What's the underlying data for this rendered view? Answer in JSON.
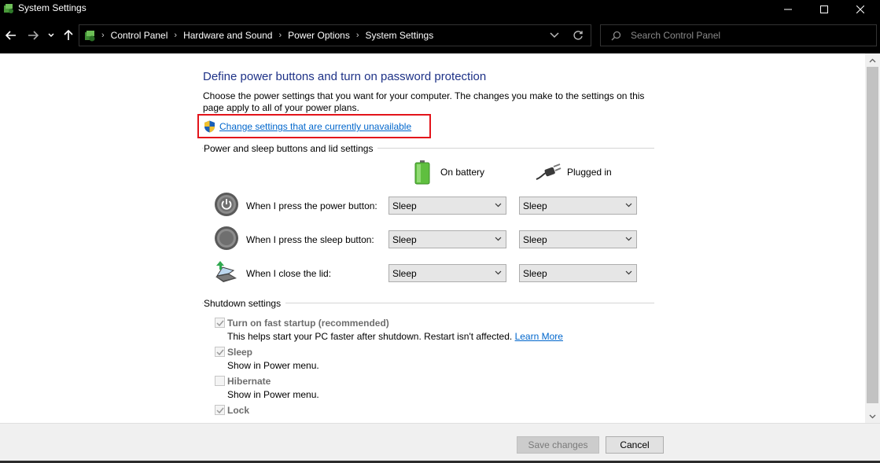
{
  "window": {
    "title": "System Settings"
  },
  "address_bar": {
    "breadcrumbs": [
      "Control Panel",
      "Hardware and Sound",
      "Power Options",
      "System Settings"
    ],
    "search_placeholder": "Search Control Panel"
  },
  "page": {
    "heading": "Define power buttons and turn on password protection",
    "description": "Choose the power settings that you want for your computer. The changes you make to the settings on this page apply to all of your power plans.",
    "change_settings_link": "Change settings that are currently unavailable"
  },
  "power_buttons": {
    "group_title": "Power and sleep buttons and lid settings",
    "columns": {
      "battery": "On battery",
      "plugged": "Plugged in"
    },
    "rows": [
      {
        "label": "When I press the power button:",
        "battery": "Sleep",
        "plugged": "Sleep"
      },
      {
        "label": "When I press the sleep button:",
        "battery": "Sleep",
        "plugged": "Sleep"
      },
      {
        "label": "When I close the lid:",
        "battery": "Sleep",
        "plugged": "Sleep"
      }
    ]
  },
  "shutdown": {
    "group_title": "Shutdown settings",
    "items": [
      {
        "label": "Turn on fast startup (recommended)",
        "checked": true,
        "description": "This helps start your PC faster after shutdown. Restart isn't affected.",
        "link": "Learn More"
      },
      {
        "label": "Sleep",
        "checked": true,
        "description": "Show in Power menu."
      },
      {
        "label": "Hibernate",
        "checked": false,
        "description": "Show in Power menu."
      },
      {
        "label": "Lock",
        "checked": true,
        "description": ""
      }
    ]
  },
  "footer": {
    "save_label": "Save changes",
    "cancel_label": "Cancel"
  },
  "colors": {
    "heading": "#1e3287",
    "link": "#0066cc",
    "highlight_box": "#e3141b"
  }
}
